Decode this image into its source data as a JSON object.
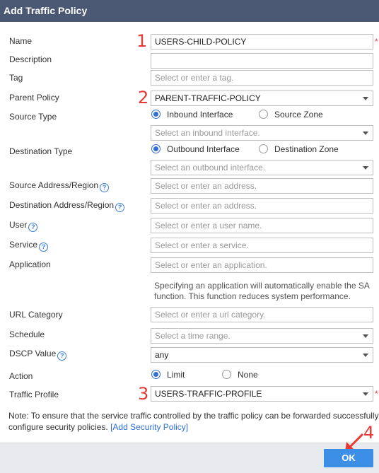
{
  "dialog": {
    "title": "Add Traffic Policy"
  },
  "annotations": [
    "1",
    "2",
    "3",
    "4"
  ],
  "form": {
    "name": {
      "label": "Name",
      "value": "USERS-CHILD-POLICY",
      "required": "*"
    },
    "description": {
      "label": "Description",
      "value": ""
    },
    "tag": {
      "label": "Tag",
      "placeholder": "Select or enter a tag."
    },
    "parent_policy": {
      "label": "Parent Policy",
      "value": "PARENT-TRAFFIC-POLICY"
    },
    "source_type": {
      "label": "Source Type",
      "options": [
        "Inbound Interface",
        "Source Zone"
      ],
      "selected": "Inbound Interface",
      "select_placeholder": "Select an inbound interface."
    },
    "destination_type": {
      "label": "Destination Type",
      "options": [
        "Outbound Interface",
        "Destination Zone"
      ],
      "selected": "Outbound Interface",
      "select_placeholder": "Select an outbound interface."
    },
    "source_address": {
      "label": "Source Address/Region",
      "placeholder": "Select or enter an address."
    },
    "destination_address": {
      "label": "Destination Address/Region",
      "placeholder": "Select or enter an address."
    },
    "user": {
      "label": "User",
      "placeholder": "Select or enter a user name."
    },
    "service": {
      "label": "Service",
      "placeholder": "Select or enter a service."
    },
    "application": {
      "label": "Application",
      "placeholder": "Select or enter an application.",
      "hint": "Specifying an application will automatically enable the SA function. This function reduces system performance."
    },
    "url_category": {
      "label": "URL Category",
      "placeholder": "Select or enter a url category."
    },
    "schedule": {
      "label": "Schedule",
      "placeholder": "Select a time range."
    },
    "dscp_value": {
      "label": "DSCP Value",
      "value": "any"
    },
    "action": {
      "label": "Action",
      "options": [
        "Limit",
        "None"
      ],
      "selected": "Limit"
    },
    "traffic_profile": {
      "label": "Traffic Profile",
      "value": "USERS-TRAFFIC-PROFILE",
      "required": "*"
    }
  },
  "note": {
    "text": "Note: To ensure that the service traffic controlled by the traffic policy can be forwarded successfully, configure security policies.",
    "link": "[Add Security Policy]"
  },
  "footer": {
    "ok_label": "OK"
  },
  "colors": {
    "title_bar": "#4a5873",
    "accent": "#2f6fd6",
    "ok_button": "#3d8ee6",
    "annotation": "#e53935"
  }
}
